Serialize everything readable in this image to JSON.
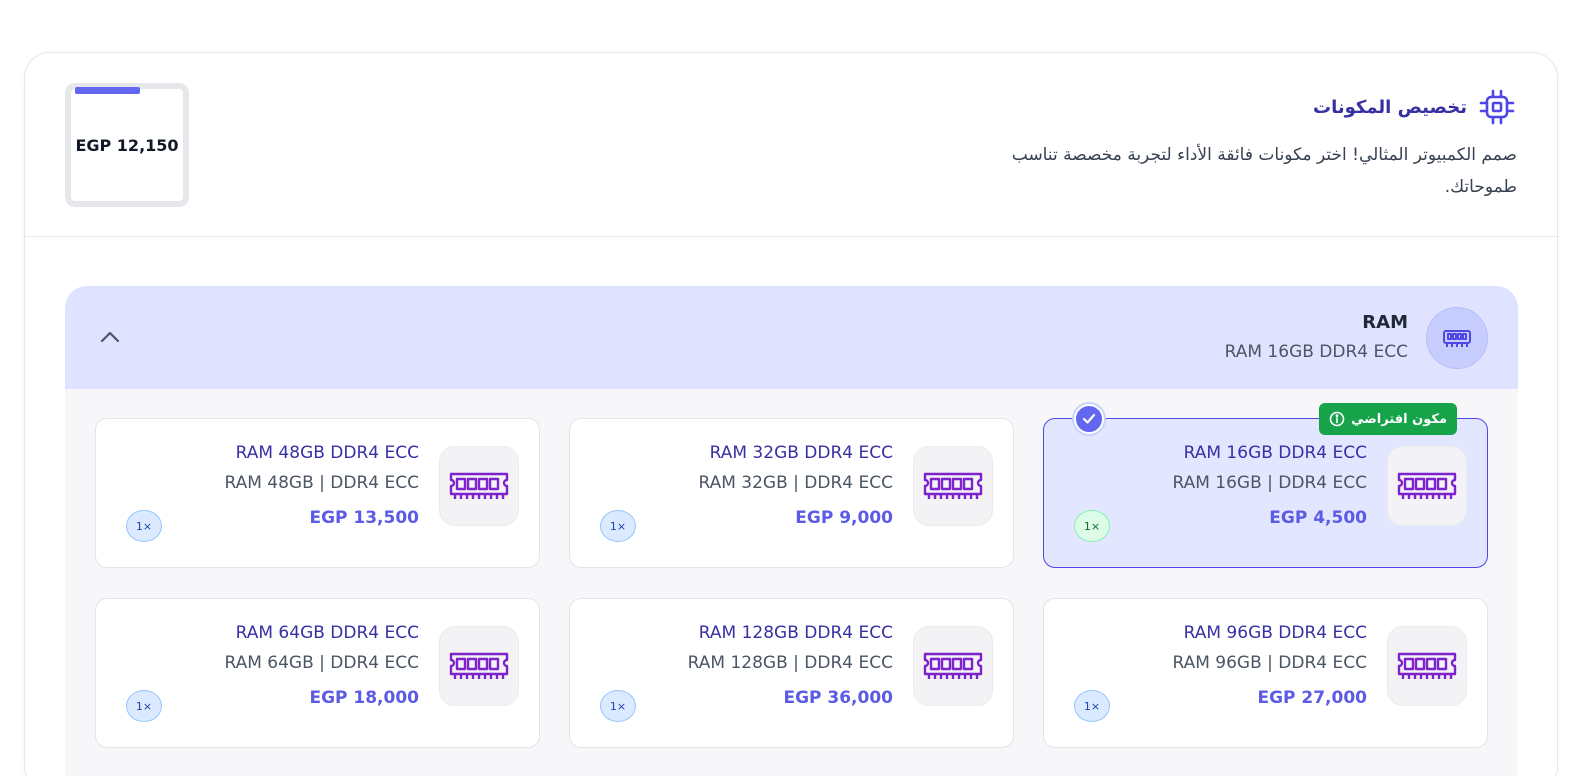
{
  "header": {
    "title": "تخصيص المكونات",
    "description": "صمم الكمبيوتر المثالي! اختر مكونات فائقة الأداء لتجربة مخصصة تناسب طموحاتك.",
    "icon": "cpu-chip-icon",
    "total_price": "EGP 12,150",
    "progress_fraction": 0.6
  },
  "section": {
    "title": "RAM",
    "selected": "RAM 16GB DDR4 ECC",
    "icon": "memory-icon",
    "collapse_icon": "chevron-up-icon"
  },
  "options": [
    {
      "name": "RAM 16GB DDR4 ECC",
      "spec": "RAM 16GB | DDR4 ECC",
      "price": "EGP 4,500",
      "qty": "1×",
      "selected": true,
      "badge": "مكون افتراضي"
    },
    {
      "name": "RAM 32GB DDR4 ECC",
      "spec": "RAM 32GB | DDR4 ECC",
      "price": "EGP 9,000",
      "qty": "1×",
      "selected": false
    },
    {
      "name": "RAM 48GB DDR4 ECC",
      "spec": "RAM 48GB | DDR4 ECC",
      "price": "EGP 13,500",
      "qty": "1×",
      "selected": false
    },
    {
      "name": "RAM 96GB DDR4 ECC",
      "spec": "RAM 96GB | DDR4 ECC",
      "price": "EGP 27,000",
      "qty": "1×",
      "selected": false
    },
    {
      "name": "RAM 128GB DDR4 ECC",
      "spec": "RAM 128GB | DDR4 ECC",
      "price": "EGP 36,000",
      "qty": "1×",
      "selected": false
    },
    {
      "name": "RAM 64GB DDR4 ECC",
      "spec": "RAM 64GB | DDR4 ECC",
      "price": "EGP 18,000",
      "qty": "1×",
      "selected": false
    }
  ],
  "colors": {
    "accent": "#6366f1",
    "title": "#3730a3",
    "ram_icon": "#7e22ce",
    "badge_green": "#16a34a"
  }
}
